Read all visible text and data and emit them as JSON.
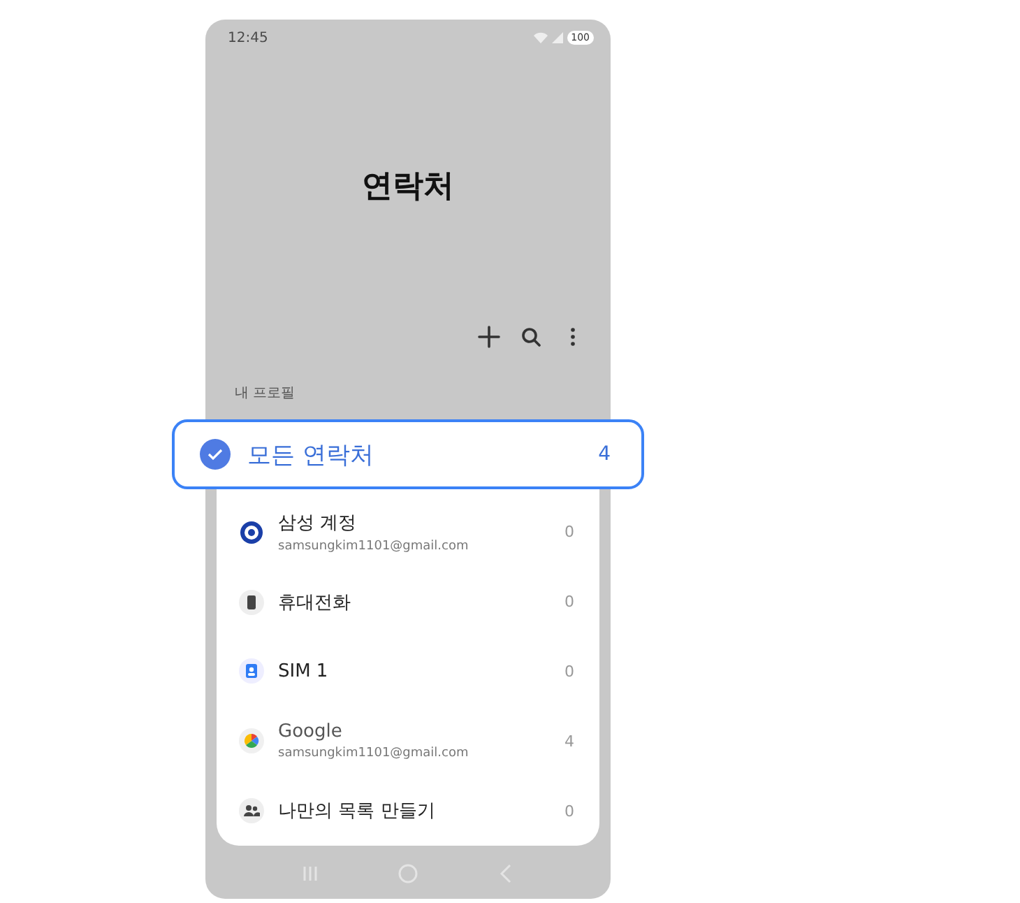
{
  "status_bar": {
    "time": "12:45",
    "battery": "100"
  },
  "title": "연락처",
  "toolbar": [
    {
      "kind": "add"
    },
    {
      "kind": "search"
    },
    {
      "kind": "more"
    }
  ],
  "section_label": "내 프로필",
  "all_contacts": {
    "label": "모든 연락처",
    "count": "4",
    "selected": true
  },
  "accounts": [
    {
      "kind": "samsung",
      "name": "삼성 계정",
      "email": "samsungkim1101@gmail.com",
      "count": "0"
    },
    {
      "kind": "phone",
      "name": "휴대전화",
      "count": "0"
    },
    {
      "kind": "sim",
      "name": "SIM 1",
      "count": "0"
    },
    {
      "kind": "google",
      "name": "Google",
      "email": "samsungkim1101@gmail.com",
      "count": "4"
    },
    {
      "kind": "group",
      "name": "나만의 목록 만들기",
      "count": "0"
    }
  ],
  "nav": [
    {
      "kind": "recents"
    },
    {
      "kind": "home"
    },
    {
      "kind": "back"
    }
  ]
}
